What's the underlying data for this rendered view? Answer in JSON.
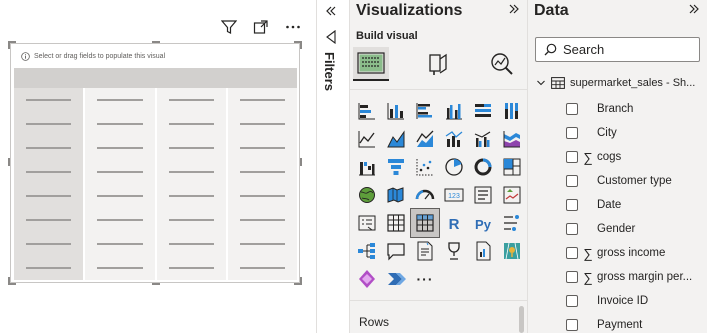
{
  "canvas": {
    "placeholder_text": "Select or drag fields to populate this visual",
    "header_icons": [
      "filter-icon",
      "focus-mode-icon",
      "more-options-icon"
    ],
    "more_label": "···"
  },
  "filters": {
    "label": "Filters",
    "collapse_glyph": "«"
  },
  "visualizations": {
    "title": "Visualizations",
    "collapse_glyph": "»",
    "build_visual_label": "Build visual",
    "build_tabs": [
      "build-visual",
      "format-visual",
      "analytics"
    ],
    "icons": [
      "stacked-bar-chart",
      "stacked-column-chart",
      "clustered-bar-chart",
      "clustered-column-chart",
      "100-stacked-bar-chart",
      "100-stacked-column-chart",
      "line-chart",
      "area-chart",
      "stacked-area-chart",
      "line-and-stacked-column-chart",
      "line-and-clustered-column-chart",
      "ribbon-chart",
      "waterfall-chart",
      "funnel-chart",
      "scatter-chart",
      "pie-chart",
      "donut-chart",
      "treemap",
      "map",
      "filled-map",
      "gauge",
      "card",
      "multi-row-card",
      "kpi",
      "slicer",
      "table",
      "matrix",
      "r-visual",
      "python-visual",
      "key-influencers",
      "decomposition-tree",
      "q-and-a",
      "smart-narrative",
      "goals",
      "paginated-report",
      "azure-map",
      "power-apps",
      "power-automate",
      "more-visuals"
    ],
    "selected_icon": "matrix",
    "more_label": "···",
    "rows_label": "Rows"
  },
  "data_pane": {
    "title": "Data",
    "collapse_glyph": "»",
    "search_placeholder": "Search",
    "table_name": "supermarket_sales - Sh...",
    "sigma_glyph": "∑",
    "fields": [
      {
        "name": "Branch",
        "numeric": false
      },
      {
        "name": "City",
        "numeric": false
      },
      {
        "name": "cogs",
        "numeric": true
      },
      {
        "name": "Customer type",
        "numeric": false
      },
      {
        "name": "Date",
        "numeric": false
      },
      {
        "name": "Gender",
        "numeric": false
      },
      {
        "name": "gross income",
        "numeric": true
      },
      {
        "name": "gross margin per...",
        "numeric": true
      },
      {
        "name": "Invoice ID",
        "numeric": false
      },
      {
        "name": "Payment",
        "numeric": false
      }
    ]
  }
}
